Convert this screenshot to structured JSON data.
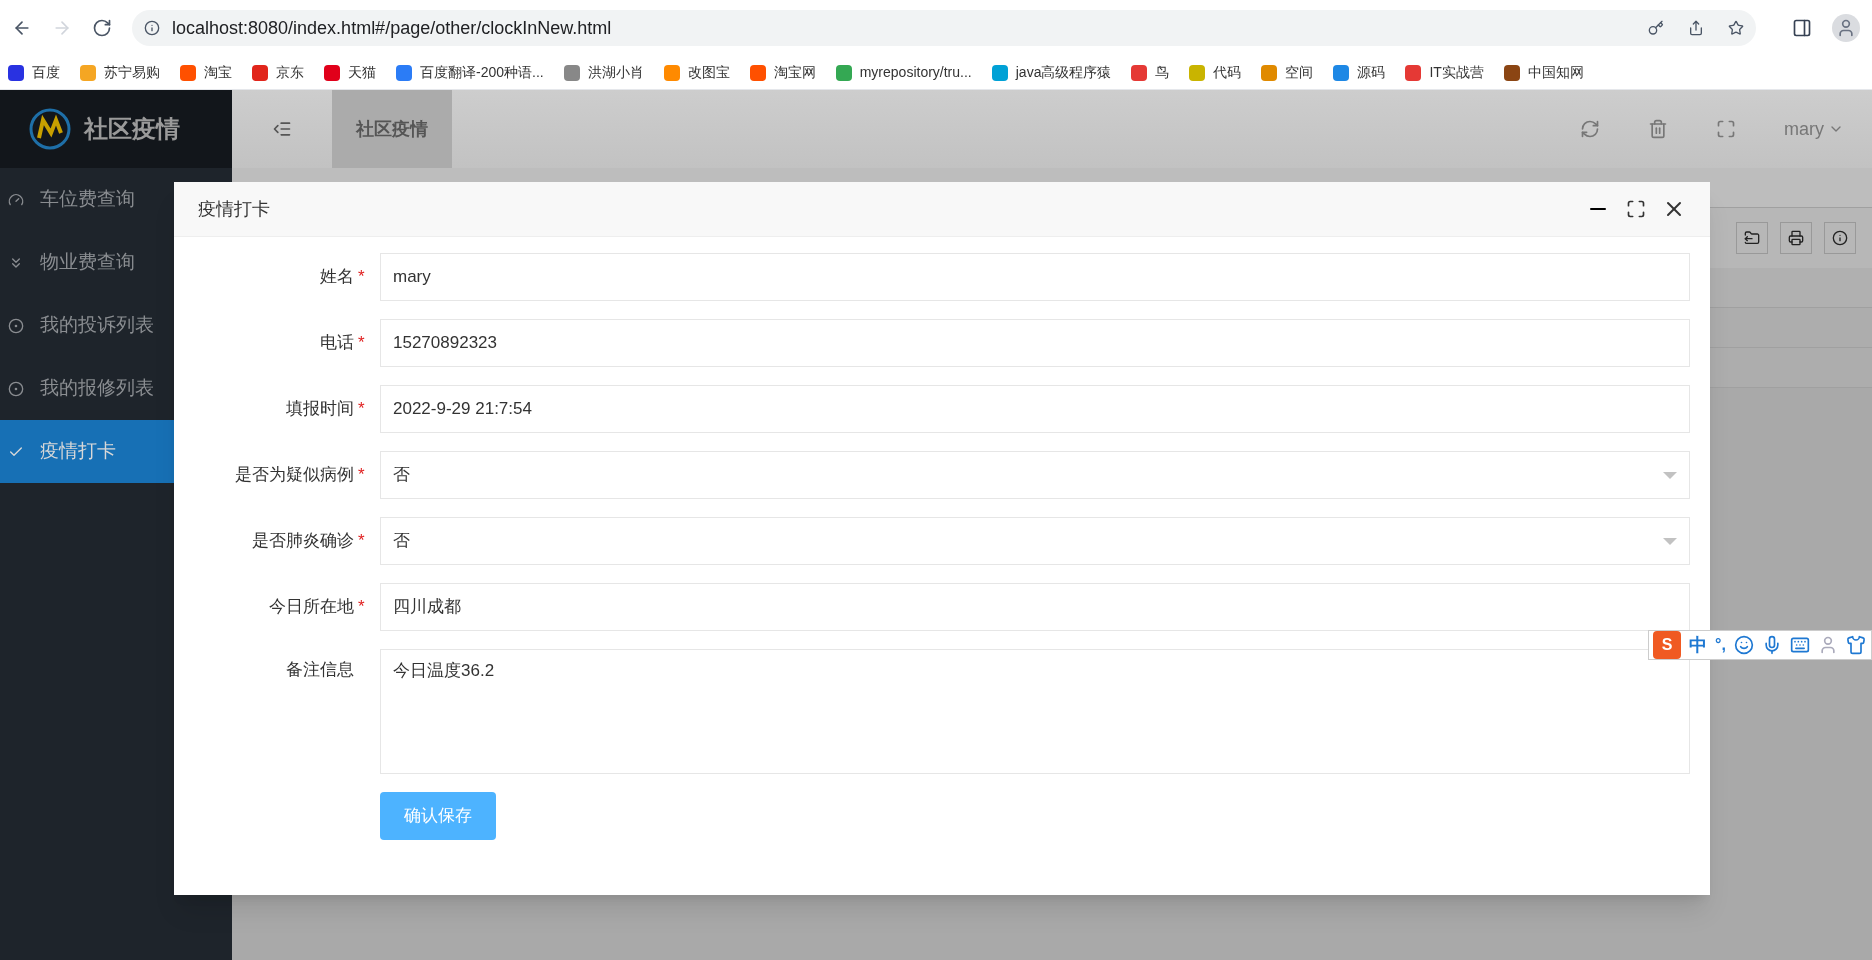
{
  "browser": {
    "url": "localhost:8080/index.html#/page/other/clockInNew.html",
    "bookmarks": [
      {
        "label": "百度",
        "color": "#2932e1"
      },
      {
        "label": "苏宁易购",
        "color": "#f5a623"
      },
      {
        "label": "淘宝",
        "color": "#ff5000"
      },
      {
        "label": "京东",
        "color": "#e1251b"
      },
      {
        "label": "天猫",
        "color": "#e1001a"
      },
      {
        "label": "百度翻译-200种语...",
        "color": "#2b7cf6"
      },
      {
        "label": "洪湖小肖",
        "color": "#888888"
      },
      {
        "label": "改图宝",
        "color": "#ff8a00"
      },
      {
        "label": "淘宝网",
        "color": "#ff5000"
      },
      {
        "label": "myrepository/tru...",
        "color": "#34a853"
      },
      {
        "label": "java高级程序猿",
        "color": "#00a1d6"
      },
      {
        "label": "鸟",
        "color": "#e53935"
      },
      {
        "label": "代码",
        "color": "#c9b400"
      },
      {
        "label": "空间",
        "color": "#e08a00"
      },
      {
        "label": "源码",
        "color": "#1e88e5"
      },
      {
        "label": "IT实战营",
        "color": "#e53935"
      },
      {
        "label": "中国知网",
        "color": "#8b4513"
      }
    ]
  },
  "app": {
    "logo_title": "社区疫情",
    "header_tab": "社区疫情",
    "user": "mary",
    "sidebar": [
      {
        "label": "车位费查询",
        "selected": false
      },
      {
        "label": "物业费查询",
        "selected": false
      },
      {
        "label": "我的投诉列表",
        "selected": false
      },
      {
        "label": "我的报修列表",
        "selected": false
      },
      {
        "label": "疫情打卡",
        "selected": true
      }
    ]
  },
  "modal": {
    "title": "疫情打卡",
    "fields": [
      {
        "label": "姓名",
        "required": true,
        "kind": "input",
        "value": "mary"
      },
      {
        "label": "电话",
        "required": true,
        "kind": "input",
        "value": "15270892323"
      },
      {
        "label": "填报时间",
        "required": true,
        "kind": "input",
        "value": "2022-9-29 21:7:54"
      },
      {
        "label": "是否为疑似病例",
        "required": true,
        "kind": "select",
        "value": "否"
      },
      {
        "label": "是否肺炎确诊",
        "required": true,
        "kind": "select",
        "value": "否"
      },
      {
        "label": "今日所在地",
        "required": true,
        "kind": "input",
        "value": "四川成都"
      },
      {
        "label": "备注信息",
        "required": false,
        "kind": "textarea",
        "value": "今日温度36.2"
      }
    ],
    "required_mark": "*",
    "submit_button": "确认保存"
  },
  "ime": {
    "logo": "S",
    "mode": "中",
    "punctuation": "°,"
  }
}
